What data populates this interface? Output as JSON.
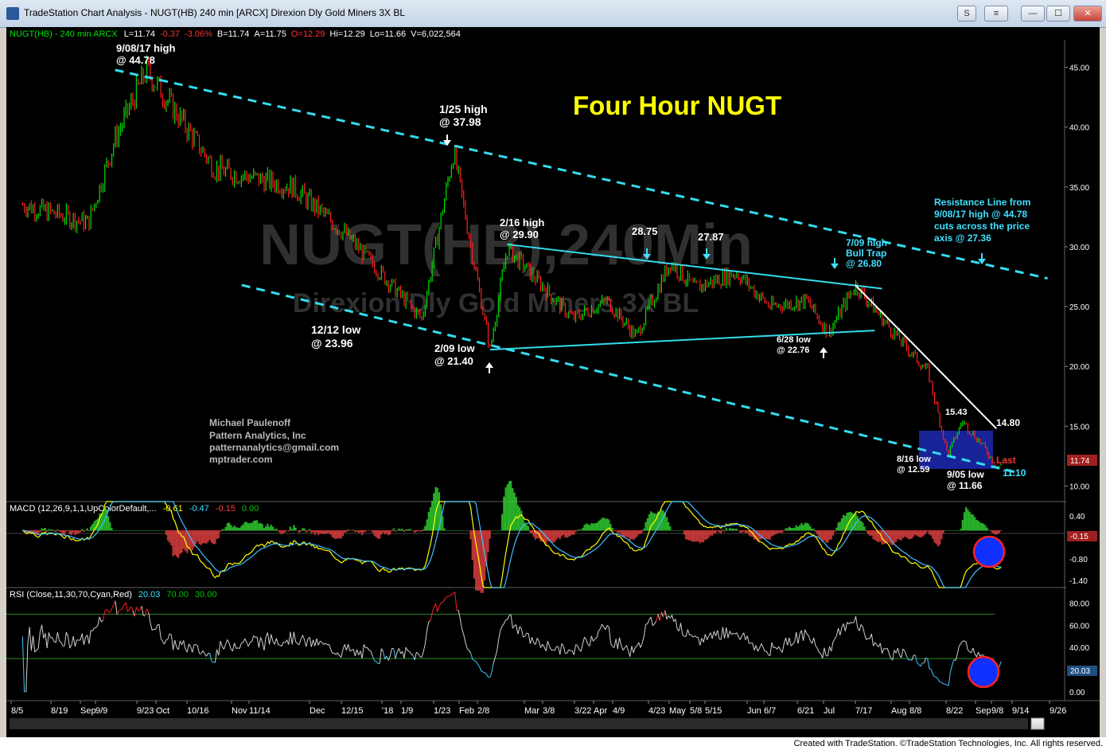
{
  "window": {
    "title": "TradeStation Chart Analysis - NUGT(HB) 240 min [ARCX] Direxion Dly Gold Miners 3X BL",
    "buttons": [
      "S",
      "≡",
      "—",
      "☐",
      "✕"
    ],
    "credit": "Created with TradeStation. ©TradeStation Technologies, Inc. All rights reserved."
  },
  "header": {
    "symbol": "NUGT(HB) - 240 min  ARCX",
    "stats": [
      {
        "text": "L=11.74",
        "color": "#ffffff"
      },
      {
        "text": "-0.37",
        "color": "#ff3030"
      },
      {
        "text": "-3.06%",
        "color": "#ff3030"
      },
      {
        "text": "B=11.74",
        "color": "#ffffff"
      },
      {
        "text": "A=11.75",
        "color": "#ffffff"
      },
      {
        "text": "O=12.29",
        "color": "#ff3030"
      },
      {
        "text": "Hi=12.29",
        "color": "#ffffff"
      },
      {
        "text": "Lo=11.66",
        "color": "#ffffff"
      },
      {
        "text": "V=6,022,564",
        "color": "#ffffff"
      }
    ]
  },
  "chart_title": "Four Hour NUGT",
  "watermark": {
    "line1": "NUGT(HB),240Min",
    "line2": "Direxion Dly Gold Miners 3X BL"
  },
  "signature": [
    "Michael Paulenoff",
    "Pattern Analytics, Inc",
    "patternanalytics@gmail.com",
    "mptrader.com"
  ],
  "colors": {
    "bg": "#000000",
    "up": "#00e000",
    "down": "#ff2020",
    "cyan": "#33ddee",
    "annot_yellow": "#ffff00",
    "note_cyan": "#40e0ff"
  },
  "chart_data": [
    {
      "type": "line",
      "name": "Price (240 min)",
      "ylim": [
        8.7,
        47.3
      ],
      "y_ticks": [
        "45.00",
        "40.00",
        "35.00",
        "30.00",
        "25.00",
        "20.00",
        "15.00",
        "10.00"
      ],
      "last_value": "11.74",
      "x_labels": [
        "8/5",
        "8/19",
        "Sep",
        "9/9",
        "9/23",
        "Oct",
        "10/16",
        "Nov",
        "11/14",
        "Dec",
        "12/15",
        "'18",
        "1/9",
        "1/23",
        "Feb",
        "2/8",
        "Mar",
        "3/8",
        "3/22",
        "Apr",
        "4/9",
        "4/23",
        "May",
        "5/8",
        "5/15",
        "Jun",
        "6/7",
        "6/21",
        "Jul",
        "7/17",
        "Aug",
        "8/8",
        "8/22",
        "Sep",
        "9/8",
        "9/14",
        "9/26"
      ],
      "x_dates": [
        "2017-08-01",
        "2017-08-28",
        "2017-09-08",
        "2017-09-21",
        "2017-10-19",
        "2017-11-20",
        "2017-12-12",
        "2018-01-12",
        "2018-01-25",
        "2018-02-09",
        "2018-02-16",
        "2018-03-15",
        "2018-03-29",
        "2018-04-10",
        "2018-04-24",
        "2018-05-04",
        "2018-05-21",
        "2018-06-04",
        "2018-06-19",
        "2018-06-28",
        "2018-07-09",
        "2018-07-24",
        "2018-08-08",
        "2018-08-16",
        "2018-08-22",
        "2018-08-30",
        "2018-09-05",
        "2018-09-07"
      ],
      "values": [
        33.5,
        32.0,
        39.0,
        44.78,
        36.5,
        35.0,
        31.0,
        23.96,
        37.98,
        21.4,
        29.9,
        24.0,
        25.5,
        22.5,
        28.75,
        26.5,
        27.87,
        25.0,
        25.5,
        22.76,
        26.8,
        23.0,
        19.5,
        12.59,
        15.43,
        13.5,
        11.66,
        11.74
      ],
      "annotations": [
        {
          "text": [
            "9/08/17 high",
            "@ 44.78"
          ],
          "color": "#ffffff"
        },
        {
          "text": [
            "1/25 high",
            "@ 37.98"
          ],
          "color": "#ffffff"
        },
        {
          "text": [
            "2/16 high",
            "@ 29.90"
          ],
          "color": "#ffffff"
        },
        {
          "text": [
            "28.75"
          ],
          "color": "#ffffff"
        },
        {
          "text": [
            "27.87"
          ],
          "color": "#ffffff"
        },
        {
          "text": [
            "7/09 high",
            "Bull Trap",
            "@ 26.80"
          ],
          "color": "#40e0ff"
        },
        {
          "text": [
            "12/12 low",
            "@ 23.96"
          ],
          "color": "#ffffff"
        },
        {
          "text": [
            "2/09 low",
            "@ 21.40"
          ],
          "color": "#ffffff"
        },
        {
          "text": [
            "6/28 low",
            "@ 22.76"
          ],
          "color": "#ffffff"
        },
        {
          "text": [
            "15.43"
          ],
          "color": "#ffffff"
        },
        {
          "text": [
            "14.80"
          ],
          "color": "#ffffff"
        },
        {
          "text": [
            "8/16 low",
            "@ 12.59"
          ],
          "color": "#ffffff"
        },
        {
          "text": [
            "9/05 low",
            "@ 11.66"
          ],
          "color": "#ffffff"
        },
        {
          "text": [
            "Last"
          ],
          "color": "#ff3030"
        },
        {
          "text": [
            "11.10"
          ],
          "color": "#40e0ff"
        },
        {
          "text": [
            "Resistance Line from",
            "9/08/17 high @ 44.78",
            "cuts across the price",
            "axis @ 27.36"
          ],
          "color": "#40e0ff"
        }
      ],
      "trend_lines": [
        {
          "name": "resistance",
          "from": [
            "2017-09-08",
            44.78
          ],
          "to": [
            "2018-09-26",
            27.36
          ],
          "style": "dashed",
          "color": "#33ddee"
        },
        {
          "name": "support",
          "from": [
            "2017-10-30",
            26.8
          ],
          "to": [
            "2018-09-14",
            11.1
          ],
          "style": "dashed",
          "color": "#33ddee"
        },
        {
          "name": "triangle-top",
          "from": [
            "2018-02-16",
            30.2
          ],
          "to": [
            "2018-07-20",
            26.5
          ],
          "style": "solid",
          "color": "#33ddee"
        },
        {
          "name": "triangle-bottom",
          "from": [
            "2018-02-09",
            21.4
          ],
          "to": [
            "2018-07-17",
            23.0
          ],
          "style": "solid",
          "color": "#33ddee"
        },
        {
          "name": "decline",
          "from": [
            "2018-07-09",
            26.8
          ],
          "to": [
            "2018-09-05",
            14.8
          ],
          "style": "solid",
          "color": "#ffffff"
        }
      ]
    },
    {
      "type": "line",
      "name": "MACD",
      "label": "MACD (12,26,9,1,1,UpColorDefault,...",
      "values_text": [
        {
          "text": "-0.61",
          "color": "#ffff00"
        },
        {
          "text": "-0.47",
          "color": "#40e0ff"
        },
        {
          "text": "-0.15",
          "color": "#ff4040"
        },
        {
          "text": "0.00",
          "color": "#00c000"
        }
      ],
      "ylim": [
        -1.6,
        0.8
      ],
      "y_ticks": [
        "0.40",
        "-0.15",
        "-0.80",
        "-1.40"
      ],
      "last_value": "-0.15"
    },
    {
      "type": "line",
      "name": "RSI",
      "label": "RSI (Close,11,30,70,Cyan,Red)",
      "values_text": [
        {
          "text": "20.03",
          "color": "#40e0ff"
        },
        {
          "text": "70.00",
          "color": "#00c000"
        },
        {
          "text": "30.00",
          "color": "#00c000"
        }
      ],
      "ylim": [
        -8,
        94
      ],
      "y_ticks": [
        "80.00",
        "60.00",
        "40.00",
        "20.00",
        "0.00"
      ],
      "levels": [
        70,
        30
      ],
      "last_value": "20.03"
    }
  ]
}
